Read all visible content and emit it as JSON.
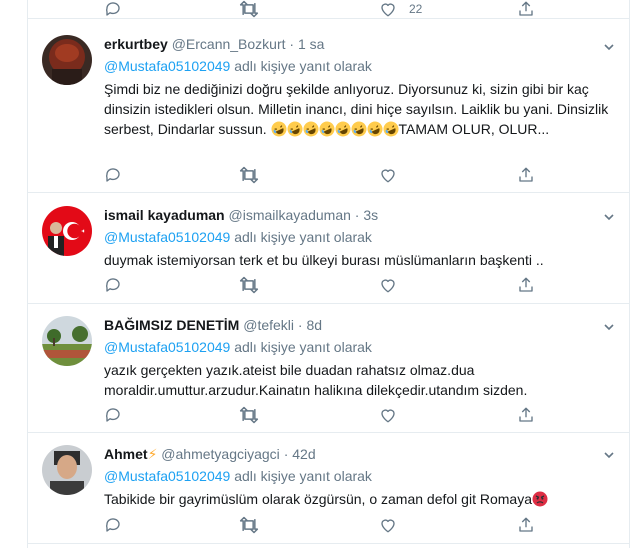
{
  "top_actions": {
    "like_count": "22"
  },
  "tweets": [
    {
      "name": "erkurtbey",
      "handle": "@Ercann_Bozkurt",
      "separator": "·",
      "time": "1 sa",
      "reply_mention": "@Mustafa05102049",
      "reply_suffix": "adlı kişiye yanıt olarak",
      "text": "Şimdi biz ne dediğinizi doğru şekilde anlıyoruz. Diyorsunuz ki, sizin gibi bir kaç dinsizin istedikleri olsun. Milletin inancı, dini hiçe sayılsın. Laiklik bu yani. Dinsizlik serbest, Dindarlar sussun.",
      "emoji_count": 8,
      "emoji_name": "rolling-on-floor-laughing",
      "text_tail": "TAMAM OLUR, OLUR..."
    },
    {
      "name": "ismail kayaduman",
      "handle": "@ismailkayaduman",
      "separator": "·",
      "time": "3s",
      "reply_mention": "@Mustafa05102049",
      "reply_suffix": "adlı kişiye yanıt olarak",
      "text": "duymak  istemiyorsan terk  et bu ülkeyi burası müslümanların başkenti .."
    },
    {
      "name": "BAĞIMSIZ DENETİM",
      "handle": "@tefekli",
      "separator": "·",
      "time": "8d",
      "reply_mention": "@Mustafa05102049",
      "reply_suffix": "adlı kişiye yanıt olarak",
      "text": "yazık gerçekten yazık.ateist bile duadan rahatsız olmaz.dua moraldir.umuttur.arzudur.Kainatın halikına dilekçedir.utandım sizden."
    },
    {
      "name": "Ahmet",
      "name_emoji": "⚡",
      "handle": "@ahmetyagciyagci",
      "separator": "·",
      "time": "42d",
      "reply_mention": "@Mustafa05102049",
      "reply_suffix": "adlı kişiye yanıt olarak",
      "text": "Tabikide bir gayrimüslüm olarak özgürsün, o zaman defol git Romaya",
      "text_emoji_name": "angry-face"
    }
  ],
  "icons": [
    "reply-icon",
    "retweet-icon",
    "like-icon",
    "share-icon",
    "chevron-down-icon"
  ],
  "colors": {
    "link": "#1da1f2",
    "muted": "#657786",
    "text": "#14171a",
    "border": "#e6ecf0",
    "emoji": "#ffcc4d",
    "angry": "#dd2e44"
  }
}
